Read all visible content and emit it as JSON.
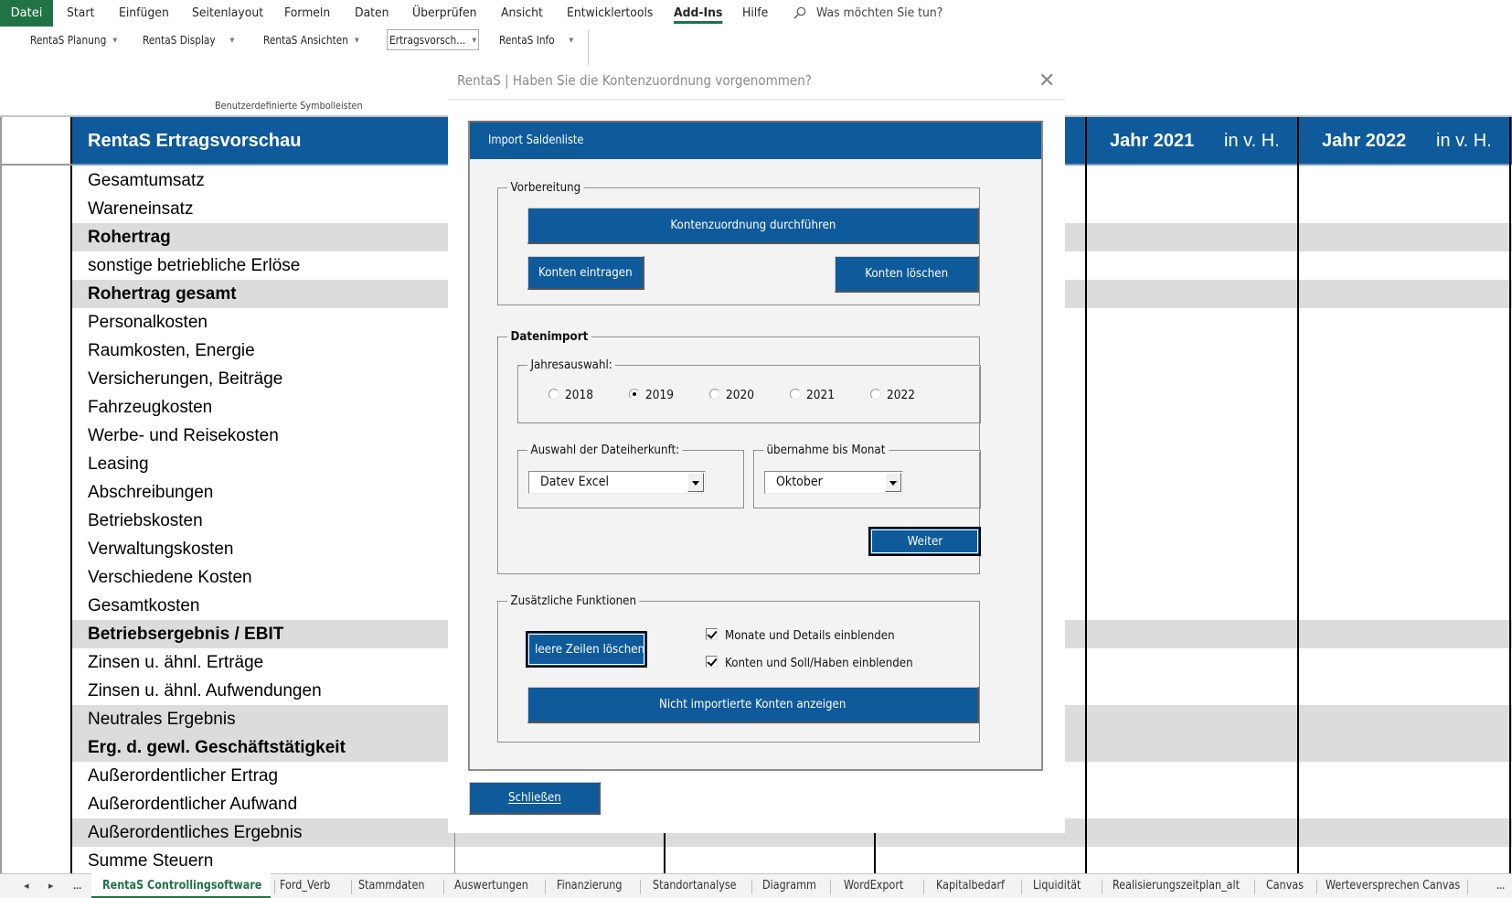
{
  "ribbon": {
    "tabs": [
      {
        "label": "Datei"
      },
      {
        "label": "Start"
      },
      {
        "label": "Einfügen"
      },
      {
        "label": "Seitenlayout"
      },
      {
        "label": "Formeln"
      },
      {
        "label": "Daten"
      },
      {
        "label": "Überprüfen"
      },
      {
        "label": "Ansicht"
      },
      {
        "label": "Entwicklertools"
      },
      {
        "label": "Add-Ins"
      },
      {
        "label": "Hilfe"
      }
    ],
    "active_tab": "Add-Ins",
    "search_placeholder": "Was möchten Sie tun?",
    "buttons": [
      {
        "label": "RentaS Planung"
      },
      {
        "label": "RentaS Display"
      },
      {
        "label": "RentaS Ansichten"
      },
      {
        "label": "Ertragsvorsch..."
      },
      {
        "label": "RentaS Info"
      }
    ],
    "group_label": "Benutzerdefinierte Symbolleisten"
  },
  "sheet": {
    "header": {
      "title": "RentaS Ertragsvorschau",
      "columns": [
        {
          "label": "Jahr 2021",
          "unit": "in v. H."
        },
        {
          "label": "Jahr 2022",
          "unit": "in v. H."
        }
      ]
    },
    "rows": [
      {
        "label": "Gesamtumsatz",
        "bold": false,
        "shaded": false
      },
      {
        "label": "Wareneinsatz",
        "bold": false,
        "shaded": false
      },
      {
        "label": "Rohertrag",
        "bold": true,
        "shaded": true
      },
      {
        "label": "sonstige betriebliche Erlöse",
        "bold": false,
        "shaded": false
      },
      {
        "label": "Rohertrag gesamt",
        "bold": true,
        "shaded": true
      },
      {
        "label": "Personalkosten",
        "bold": false,
        "shaded": false
      },
      {
        "label": "Raumkosten,  Energie",
        "bold": false,
        "shaded": false
      },
      {
        "label": "Versicherungen, Beiträge",
        "bold": false,
        "shaded": false
      },
      {
        "label": "Fahrzeugkosten",
        "bold": false,
        "shaded": false
      },
      {
        "label": "Werbe- und Reisekosten",
        "bold": false,
        "shaded": false
      },
      {
        "label": "Leasing",
        "bold": false,
        "shaded": false
      },
      {
        "label": "Abschreibungen",
        "bold": false,
        "shaded": false
      },
      {
        "label": "Betriebskosten",
        "bold": false,
        "shaded": false
      },
      {
        "label": "Verwaltungskosten",
        "bold": false,
        "shaded": false
      },
      {
        "label": "Verschiedene Kosten",
        "bold": false,
        "shaded": false
      },
      {
        "label": "Gesamtkosten",
        "bold": false,
        "shaded": false
      },
      {
        "label": "Betriebsergebnis / EBIT",
        "bold": true,
        "shaded": true
      },
      {
        "label": "Zinsen u. ähnl. Erträge",
        "bold": false,
        "shaded": false
      },
      {
        "label": "Zinsen u. ähnl. Aufwendungen",
        "bold": false,
        "shaded": false
      },
      {
        "label": "Neutrales Ergebnis",
        "bold": false,
        "shaded": true
      },
      {
        "label": "Erg. d. gewl. Geschäftstätigkeit",
        "bold": true,
        "shaded": true
      },
      {
        "label": "Außerordentlicher Ertrag",
        "bold": false,
        "shaded": false
      },
      {
        "label": "Außerordentlicher Aufwand",
        "bold": false,
        "shaded": false
      },
      {
        "label": "Außerordentliches Ergebnis",
        "bold": false,
        "shaded": true
      },
      {
        "label": "Summe Steuern",
        "bold": false,
        "shaded": false
      }
    ]
  },
  "sheet_tabs": {
    "nav": {
      "prev": "◂",
      "next": "▸",
      "more": "..."
    },
    "tabs": [
      {
        "label": "RentaS Controllingsoftware",
        "active": true
      },
      {
        "label": "Ford_Verb"
      },
      {
        "label": "Stammdaten"
      },
      {
        "label": "Auswertungen"
      },
      {
        "label": "Finanzierung"
      },
      {
        "label": "Standortanalyse"
      },
      {
        "label": "Diagramm"
      },
      {
        "label": "WordExport"
      },
      {
        "label": "Kapitalbedarf"
      },
      {
        "label": "Liquidität"
      },
      {
        "label": "Realisierungszeitplan_alt"
      },
      {
        "label": "Canvas"
      },
      {
        "label": "Werteversprechen Canvas"
      }
    ],
    "more_right": "..."
  },
  "dialog": {
    "title": "RentaS | Haben Sie die Kontenzuordnung vorgenommen?",
    "close_glyph": "✕",
    "panel_title": "Import Saldenliste",
    "vorbereitung": {
      "legend": "Vorbereitung",
      "kontenzuordnung_button": "Kontenzuordnung durchführen",
      "konten_eintragen_button": "Konten eintragen",
      "konten_loeschen_button": "Konten löschen"
    },
    "datenimport": {
      "legend": "Datenimport",
      "jahresauswahl": {
        "legend": "Jahresauswahl:",
        "options": [
          "2018",
          "2019",
          "2020",
          "2021",
          "2022"
        ],
        "selected": "2019"
      },
      "dateiherkunft": {
        "legend": "Auswahl der Dateiherkunft:",
        "value": "Datev Excel"
      },
      "monat": {
        "legend": "übernahme bis Monat",
        "value": "Oktober"
      },
      "weiter_button": "Weiter"
    },
    "zusatz": {
      "legend": "Zusätzliche Funktionen",
      "leere_zeilen_button": "leere Zeilen löschen",
      "checkboxes": [
        {
          "label": "Monate und Details einblenden",
          "checked": true
        },
        {
          "label": "Konten und Soll/Haben einblenden",
          "checked": true
        }
      ],
      "nicht_importiert_button": "Nicht importierte Konten anzeigen"
    },
    "schliessen_button": "Schließen"
  },
  "colors": {
    "excel_green": "#217346",
    "rentas_blue": "#0e5a9a",
    "row_shade": "#dcdcdc",
    "dialog_bg": "#f3f3f3"
  }
}
